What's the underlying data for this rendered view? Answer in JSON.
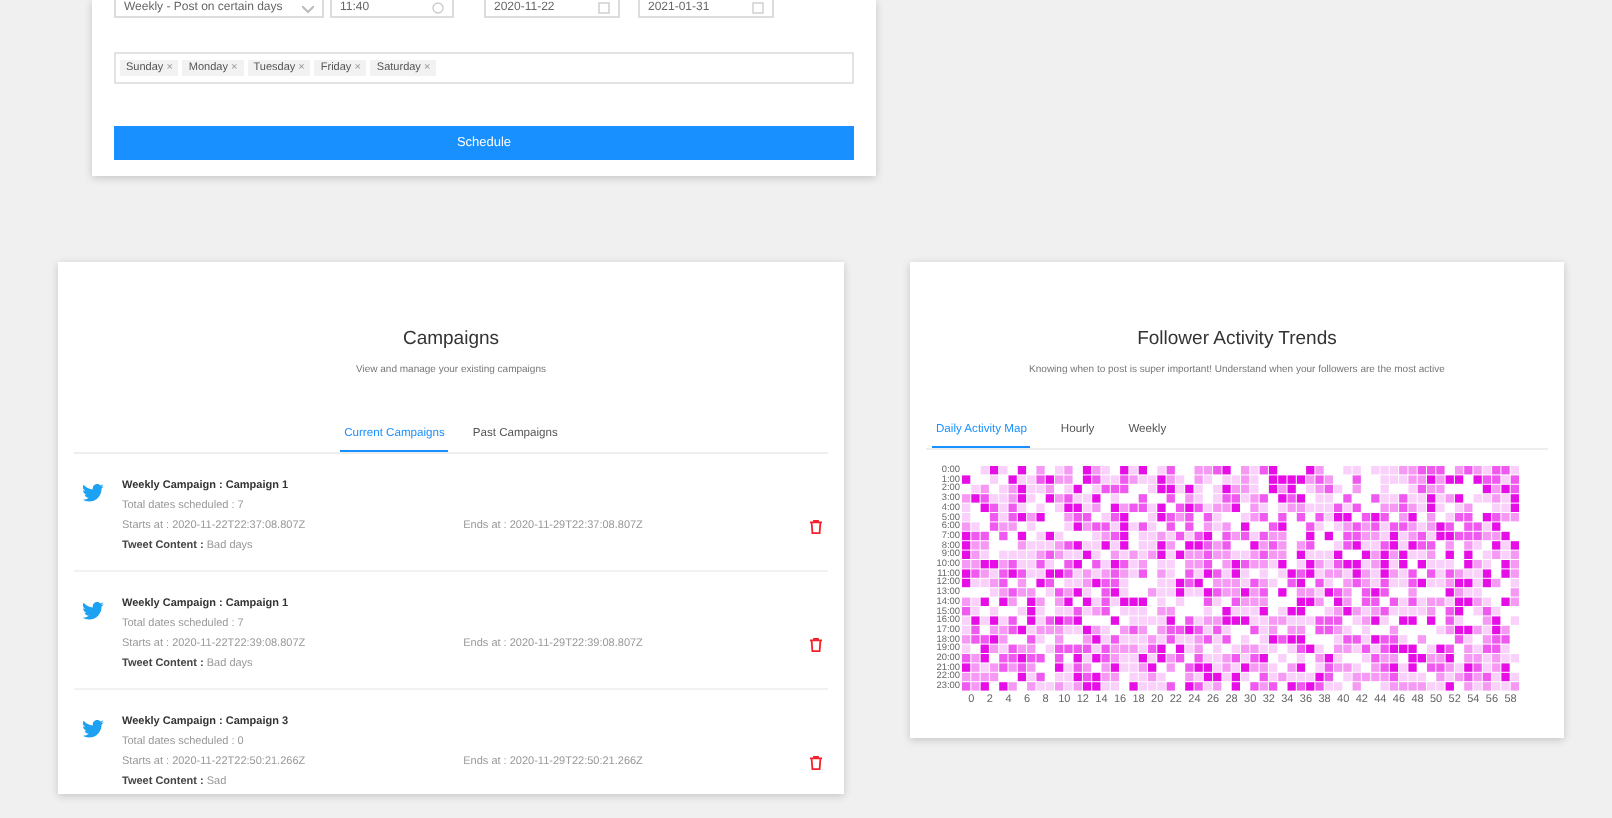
{
  "schedule_form": {
    "fields": [
      {
        "kind": "select",
        "value": "Weekly - Post on certain days"
      },
      {
        "kind": "time",
        "value": "11:40"
      },
      {
        "kind": "date",
        "value": "2020-11-22"
      },
      {
        "kind": "date",
        "value": "2021-01-31"
      }
    ],
    "days": [
      {
        "label": "Sunday",
        "remove": "×"
      },
      {
        "label": "Monday",
        "remove": "×"
      },
      {
        "label": "Tuesday",
        "remove": "×"
      },
      {
        "label": "Friday",
        "remove": "×"
      },
      {
        "label": "Saturday",
        "remove": "×"
      }
    ],
    "submit": "Schedule"
  },
  "campaigns": {
    "title": "Campaigns",
    "subtitle": "View and manage your existing campaigns",
    "tabs": [
      {
        "label": "Current Campaigns",
        "selected": true
      },
      {
        "label": "Past Campaigns",
        "selected": false
      }
    ],
    "items": [
      {
        "name": "Weekly Campaign : Campaign 1",
        "total": "Total dates scheduled : 7",
        "starts": "Starts at : 2020-11-22T22:37:08.807Z",
        "ends": "Ends at : 2020-11-29T22:37:08.807Z",
        "content_label": "Tweet Content :",
        "content": "Bad days"
      },
      {
        "name": "Weekly Campaign : Campaign 1",
        "total": "Total dates scheduled : 7",
        "starts": "Starts at : 2020-11-22T22:39:08.807Z",
        "ends": "Ends at : 2020-11-29T22:39:08.807Z",
        "content_label": "Tweet Content :",
        "content": "Bad days"
      },
      {
        "name": "Weekly Campaign : Campaign 3",
        "total": "Total dates scheduled : 0",
        "starts": "Starts at : 2020-11-22T22:50:21.266Z",
        "ends": "Ends at : 2020-11-29T22:50:21.266Z",
        "content_label": "Tweet Content :",
        "content": "Sad"
      }
    ]
  },
  "activity": {
    "title": "Follower Activity Trends",
    "subtitle": "Knowing when to post is super important! Understand when your followers are the most active",
    "tabs": [
      {
        "label": "Daily Activity Map",
        "selected": true
      },
      {
        "label": "Hourly",
        "selected": false
      },
      {
        "label": "Weekly",
        "selected": false
      }
    ],
    "heatmap": {
      "y_labels": [
        "0:00",
        "1:00",
        "2:00",
        "3:00",
        "4:00",
        "5:00",
        "6:00",
        "7:00",
        "8:00",
        "9:00",
        "10:00",
        "11:00",
        "12:00",
        "13:00",
        "14:00",
        "15:00",
        "16:00",
        "17:00",
        "18:00",
        "19:00",
        "20:00",
        "21:00",
        "22:00",
        "23:00"
      ],
      "x_labels": [
        "0",
        "2",
        "4",
        "6",
        "8",
        "10",
        "12",
        "14",
        "16",
        "18",
        "20",
        "22",
        "24",
        "26",
        "28",
        "30",
        "32",
        "34",
        "36",
        "38",
        "40",
        "42",
        "44",
        "46",
        "48",
        "50",
        "52",
        "54",
        "56",
        "58"
      ]
    }
  }
}
